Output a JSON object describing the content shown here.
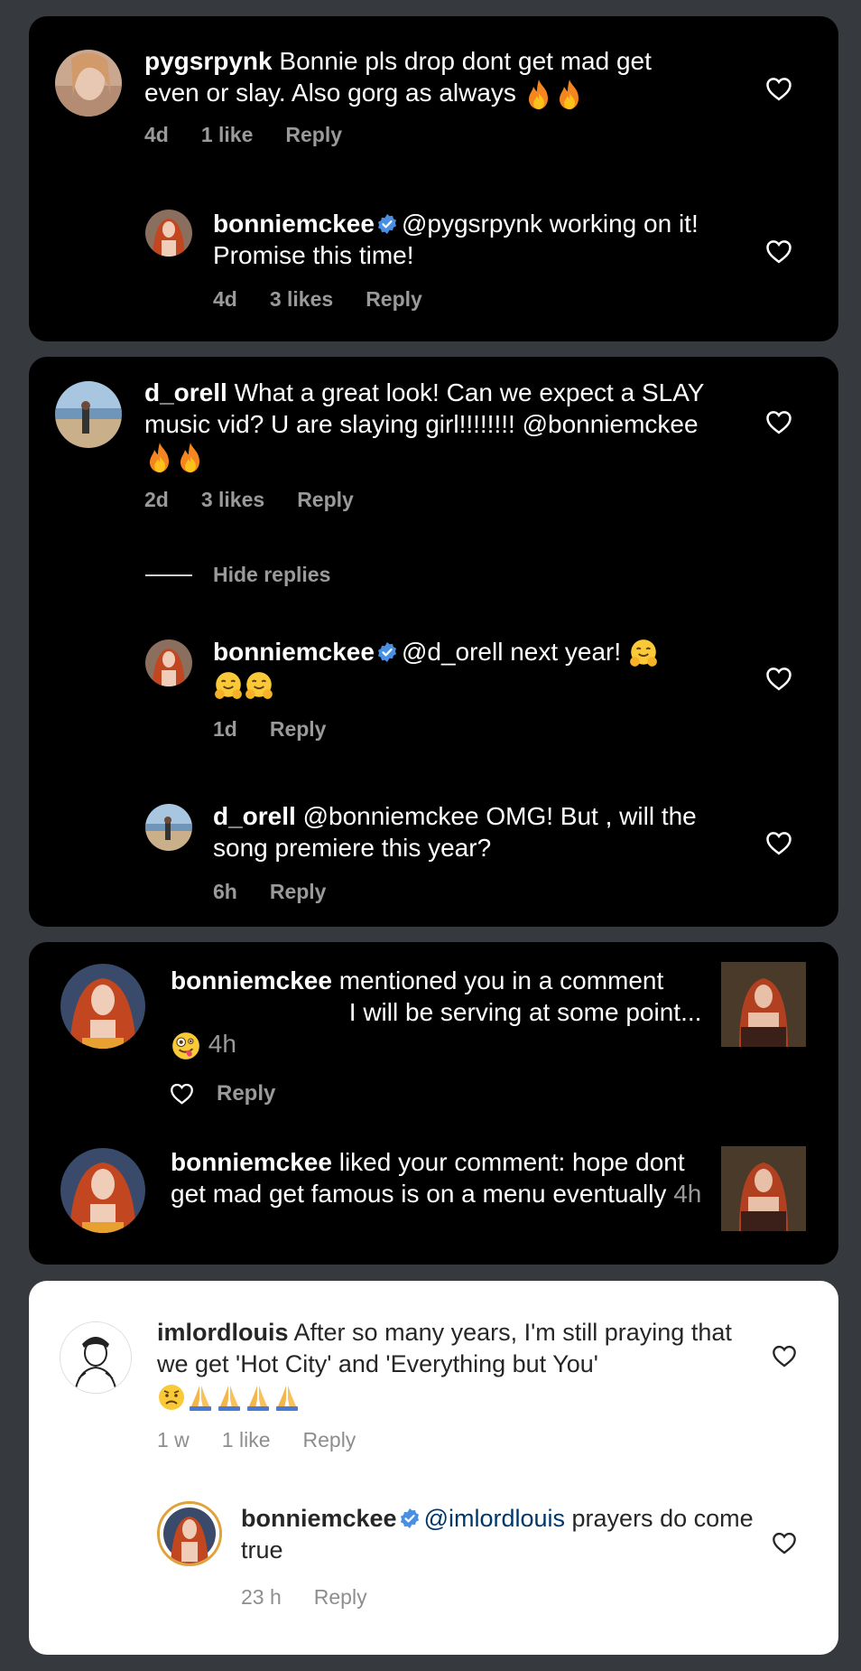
{
  "colors": {
    "background": "#36393e",
    "dark_card": "#000000",
    "light_card": "#ffffff",
    "verified": "#4a90e2"
  },
  "card1": {
    "comment": {
      "username": "pygsrpynk",
      "text": "Bonnie pls drop dont get mad get even or slay. Also gorg as always",
      "time": "4d",
      "likes": "1 like",
      "reply": "Reply"
    },
    "reply": {
      "username": "bonniemckee",
      "text": "@pygsrpynk working on it! Promise this time!",
      "time": "4d",
      "likes": "3 likes",
      "reply": "Reply"
    }
  },
  "card2": {
    "comment": {
      "username": "d_orell",
      "text": "What a great look! Can we expect a SLAY music vid? U are slaying girl!!!!!!!! @bonniemckee",
      "time": "2d",
      "likes": "3 likes",
      "reply": "Reply"
    },
    "hide_replies": "Hide replies",
    "reply1": {
      "username": "bonniemckee",
      "text": "@d_orell next year!",
      "time": "1d",
      "reply": "Reply"
    },
    "reply2": {
      "username": "d_orell",
      "text": "@bonniemckee OMG! But , will the song premiere this year?",
      "time": "6h",
      "reply": "Reply"
    }
  },
  "card3": {
    "notif1": {
      "username": "bonniemckee",
      "text_a": "mentioned you in a comment",
      "text_b": "I will be serving at some point...",
      "time": "4h",
      "reply": "Reply"
    },
    "notif2": {
      "username": "bonniemckee",
      "text": "liked your comment: hope dont get mad get famous is on a menu eventually",
      "time": "4h"
    }
  },
  "card4": {
    "comment": {
      "username": "imlordlouis",
      "text": "After so many years, I'm still praying that we get 'Hot City' and 'Everything but You'",
      "time": "1 w",
      "likes": "1 like",
      "reply": "Reply"
    },
    "reply": {
      "username": "bonniemckee",
      "mention": "@imlordlouis",
      "text": "prayers do come true",
      "time": "23 h",
      "reply": "Reply"
    }
  }
}
